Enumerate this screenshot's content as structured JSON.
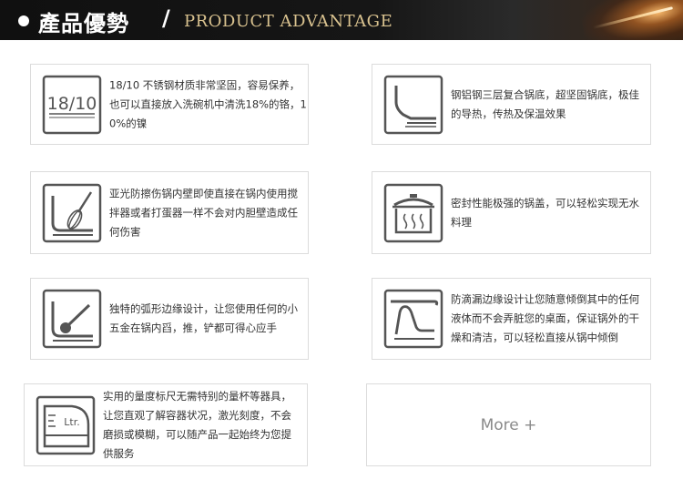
{
  "header": {
    "title_cn": "產品優勢",
    "slash": "/",
    "title_en": "PRODUCT ADVANTAGE"
  },
  "features": [
    {
      "icon": "18-10-steel-icon",
      "icon_label": "18/10",
      "text": "18/10 不锈钢材质非常坚固，容易保养，也可以直接放入洗碗机中清洗18%的铬，10%的镍"
    },
    {
      "icon": "whisk-in-pot-icon",
      "text": "亚光防擦伤锅内壁即使直接在锅内使用搅拌器或者打蛋器一样不会对内胆壁造成任何伤害"
    },
    {
      "icon": "spoon-curved-edge-icon",
      "text": "独特的弧形边缘设计，让您使用任何的小五金在锅内舀，推，铲都可得心应手"
    },
    {
      "icon": "measuring-scale-icon",
      "icon_label": "Ltr.",
      "text": "实用的量度标尺无需特别的量杯等器具，让您直观了解容器状况，激光刻度，不会磨损或模糊，可以随产品一起始终为您提供服务"
    },
    {
      "icon": "three-layer-base-icon",
      "text": "钢铝钢三层复合锅底，超坚固锅底，极佳的导热，传热及保温效果"
    },
    {
      "icon": "sealed-lid-icon",
      "text": "密封性能极强的锅盖，可以轻松实现无水料理"
    },
    {
      "icon": "drip-free-rim-icon",
      "text": "防滴漏边缘设计让您随意倾倒其中的任何液体而不会弄脏您的桌面，保证锅外的干燥和清洁，可以轻松直接从锅中倾倒"
    }
  ],
  "more_label": "More +"
}
